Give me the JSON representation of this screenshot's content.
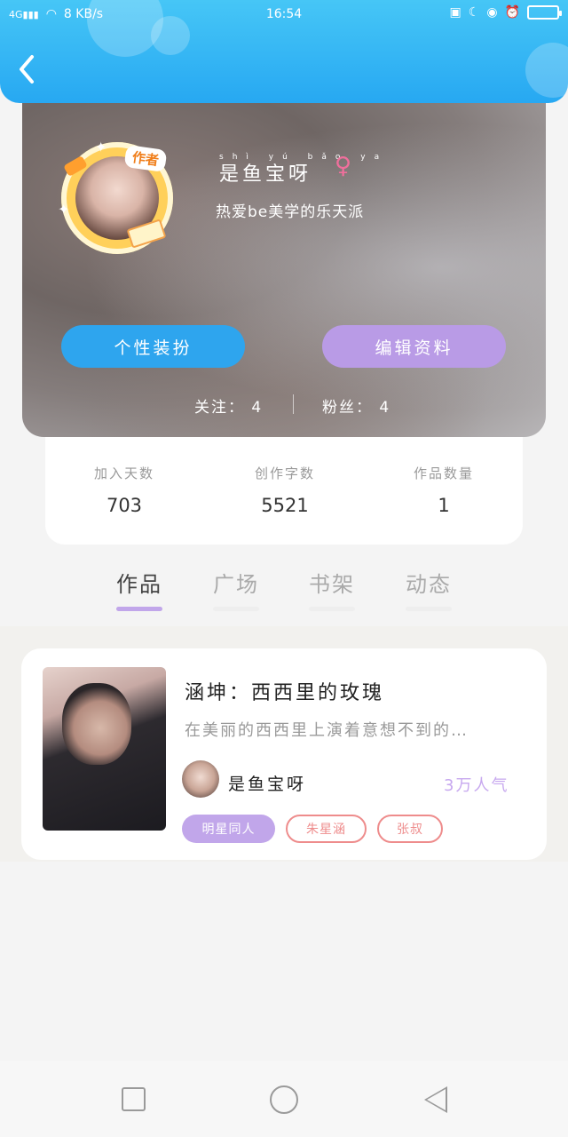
{
  "status_bar": {
    "network": "4G",
    "speed": "8 KB/s",
    "time": "16:54"
  },
  "profile": {
    "name": "是鱼宝呀",
    "name_pinyin": "shì yú bǎo ya",
    "gender": "♀",
    "bio": "热爱be美学的乐天派",
    "author_badge": "作者",
    "buttons": {
      "dress_up": "个性装扮",
      "edit_profile": "编辑资料"
    },
    "follow": {
      "following_label": "关注：",
      "following_count": "4",
      "fans_label": "粉丝：",
      "fans_count": "4"
    }
  },
  "stats": [
    {
      "label": "加入天数",
      "value": "703"
    },
    {
      "label": "创作字数",
      "value": "5521"
    },
    {
      "label": "作品数量",
      "value": "1"
    }
  ],
  "tabs": [
    {
      "label": "作品",
      "active": true
    },
    {
      "label": "广场",
      "active": false
    },
    {
      "label": "书架",
      "active": false
    },
    {
      "label": "动态",
      "active": false
    }
  ],
  "work": {
    "title": "涵坤：西西里的玫瑰",
    "description": "在美丽的西西里上演着意想不到的…",
    "author": "是鱼宝呀",
    "popularity": "3万人气",
    "tags": [
      "明星同人",
      "朱星涵",
      "张叔"
    ]
  },
  "colors": {
    "header_blue": "#2ea5ee",
    "accent_purple": "#c1a6ea",
    "tag_red": "#ee8c8c"
  }
}
